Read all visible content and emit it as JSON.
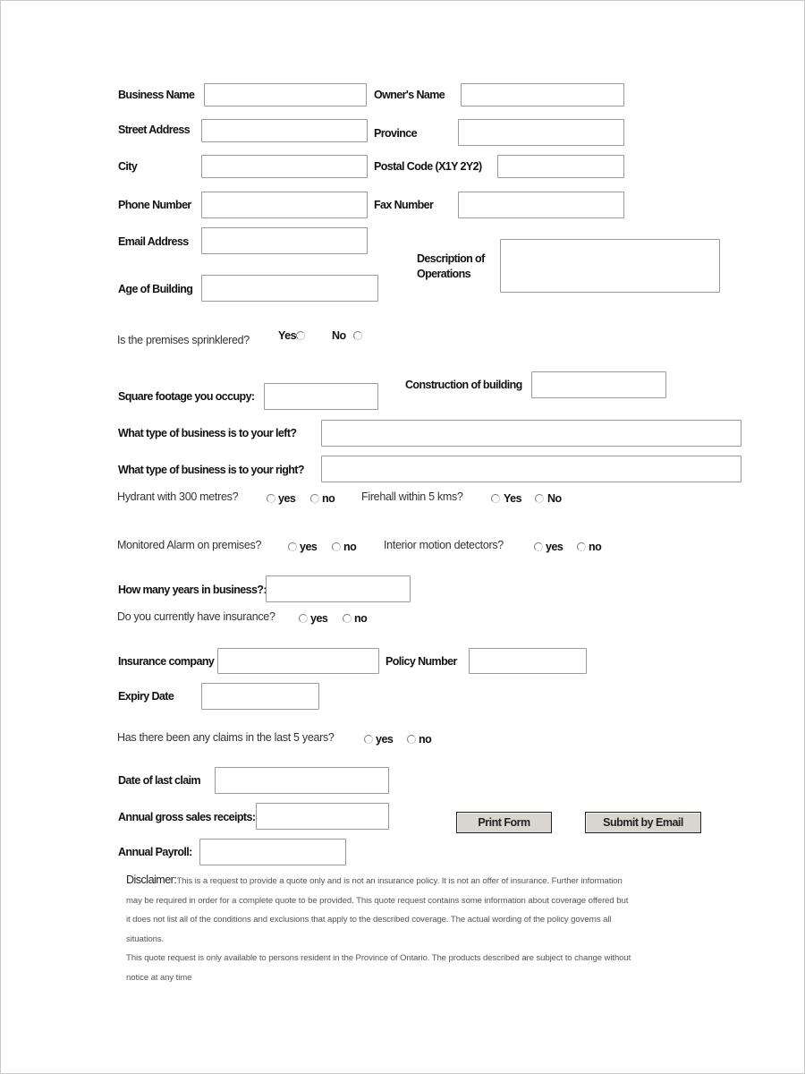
{
  "form": {
    "fields": {
      "business_name": {
        "label": "Business Name",
        "value": ""
      },
      "owners_name": {
        "label": "Owner's Name",
        "value": ""
      },
      "street_address": {
        "label": "Street Address",
        "value": ""
      },
      "province": {
        "label": "Province",
        "value": ""
      },
      "city": {
        "label": "City",
        "value": ""
      },
      "postal_code": {
        "label": "Postal Code (X1Y 2Y2)",
        "value": ""
      },
      "phone_number": {
        "label": "Phone Number",
        "value": ""
      },
      "fax_number": {
        "label": "Fax Number",
        "value": ""
      },
      "email_address": {
        "label": "Email Address",
        "value": ""
      },
      "description_of_operations": {
        "label_line1": "Description of",
        "label_line2": "Operations",
        "value": ""
      },
      "age_of_building": {
        "label": "Age of Building",
        "value": ""
      },
      "square_footage": {
        "label": "Square footage you occupy:",
        "value": ""
      },
      "construction_of_building": {
        "label": "Construction of building",
        "value": ""
      },
      "business_left": {
        "label": "What type of business is to your left?",
        "value": ""
      },
      "business_right": {
        "label": "What type of business is to your right?",
        "value": ""
      },
      "years_in_business": {
        "label": "How many years in business?:",
        "value": ""
      },
      "insurance_company": {
        "label": "Insurance company",
        "value": ""
      },
      "policy_number": {
        "label": "Policy Number",
        "value": ""
      },
      "expiry_date": {
        "label": "Expiry Date",
        "value": ""
      },
      "date_of_last_claim": {
        "label": "Date of last claim",
        "value": ""
      },
      "annual_gross_sales": {
        "label": "Annual gross sales receipts:",
        "value": ""
      },
      "annual_payroll": {
        "label": "Annual Payroll:",
        "value": ""
      }
    },
    "questions": {
      "sprinklered": {
        "label": "Is the premises sprinklered?",
        "yes": "Yes",
        "no": "No",
        "selected": null
      },
      "hydrant": {
        "label": "Hydrant with 300 metres?",
        "yes": "yes",
        "no": "no",
        "selected": null
      },
      "firehall": {
        "label": "Firehall within 5 kms?",
        "yes": "Yes",
        "no": "No",
        "selected": null
      },
      "monitored_alarm": {
        "label": "Monitored Alarm on premises?",
        "yes": "yes",
        "no": "no",
        "selected": null
      },
      "motion_detectors": {
        "label": "Interior motion detectors?",
        "yes": "yes",
        "no": "no",
        "selected": null
      },
      "current_insurance": {
        "label": "Do you currently have insurance?",
        "yes": "yes",
        "no": "no",
        "selected": null
      },
      "claims_last_5_years": {
        "label": "Has there been any claims in the last 5 years?",
        "yes": "yes",
        "no": "no",
        "selected": null
      }
    },
    "buttons": {
      "print": "Print Form",
      "submit": "Submit by Email"
    },
    "disclaimer": {
      "heading": "Disclaimer:",
      "line1": "This is a request to provide a quote only and is not an insurance policy. It is not an offer of insurance. Further information",
      "line2": "may be required in order for a complete quote to be provided. This quote request contains some information about coverage offered but",
      "line3": "it does not list all of the conditions and exclusions that apply to the described coverage. The actual wording of the policy governs all",
      "line4": "situations.",
      "line5": "This quote request is only available to persons resident in the Province of Ontario. The products described are subject to change without",
      "line6": "notice at any time"
    }
  }
}
